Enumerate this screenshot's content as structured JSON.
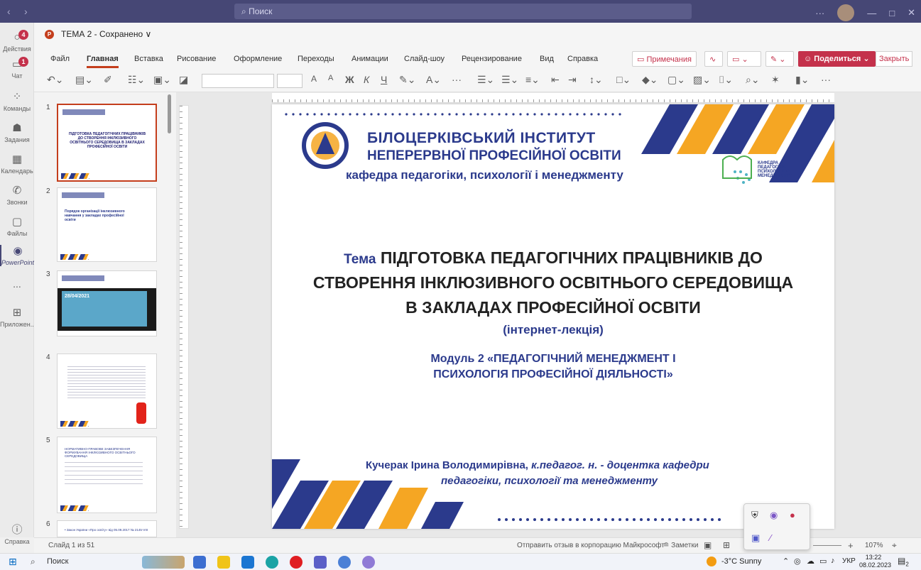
{
  "titlebar": {
    "search_placeholder": "Поиск"
  },
  "rail": [
    {
      "label": "Действия",
      "icon": "bell-icon",
      "badge": "4"
    },
    {
      "label": "Чат",
      "icon": "chat-icon",
      "badge": "1"
    },
    {
      "label": "Команды",
      "icon": "teams-icon"
    },
    {
      "label": "Задания",
      "icon": "assignments-icon"
    },
    {
      "label": "Календарь",
      "icon": "calendar-icon"
    },
    {
      "label": "Звонки",
      "icon": "phone-icon"
    },
    {
      "label": "Файлы",
      "icon": "files-icon"
    },
    {
      "label": "PowerPoint",
      "icon": "powerpoint-icon"
    },
    {
      "label": "...",
      "icon": "more-icon"
    },
    {
      "label": "Приложен...",
      "icon": "apps-icon"
    },
    {
      "label": "Справка",
      "icon": "help-icon"
    }
  ],
  "document": {
    "logo": "P",
    "title": "ТЕМА 2 - Сохранено ∨"
  },
  "menu": [
    "Файл",
    "Главная",
    "Вставка",
    "Рисование",
    "Оформление",
    "Переходы",
    "Анимации",
    "Слайд-шоу",
    "Рецензирование",
    "Вид",
    "Справка"
  ],
  "header_buttons": {
    "comments": "Примечания",
    "share": "Поделиться",
    "close": "Закрыть"
  },
  "ribbon": {
    "font_size_a": "A",
    "font_size_b": "A",
    "bold": "Ж",
    "italic": "К",
    "underline": "Ч",
    "more": "···"
  },
  "thumbnails": [
    {
      "num": "1",
      "title": "ПІДГОТОВКА ПЕДАГОГІЧНИХ ПРАЦІВНИКІВ ДО СТВОРЕННЯ ІНКЛЮЗИВНОГО ОСВІТНЬОГО СЕРЕДОВИЩА В ЗАКЛАДАХ ПРОФЕСІЙНОЇ ОСВІТИ"
    },
    {
      "num": "2",
      "title": "Порядок організації інклюзивного навчання у закладах професійної освіти"
    },
    {
      "num": "3",
      "title": "28/04/2021"
    },
    {
      "num": "4",
      "title": ""
    },
    {
      "num": "5",
      "title": "НОРМАТИВНО-ПРАВОВЕ ЗАБЕЗПЕЧЕННЯ ФОРМУВАННЯ ІНКЛЮЗИВНОГО ОСВІТНЬОГО СЕРЕДОВИЩА"
    },
    {
      "num": "6",
      "title": "• Закон України «Про освіту» від 05.09.2017 № 2145-VIII"
    }
  ],
  "slide": {
    "institute_line1": "БІЛОЦЕРКІВСЬКИЙ ІНСТИТУТ",
    "institute_line2": "НЕПЕРЕРВНОЇ ПРОФЕСІЙНОЇ ОСВІТИ",
    "department": "кафедра педагогіки, психології і менеджменту",
    "dept_logo_text": "КАФЕДРА ПЕДАГОГІКИ, ПСИХОЛОГІЇ ТА МЕНЕДЖМЕНТУ",
    "topic_prefix": "Тема",
    "topic_line1": "ПІДГОТОВКА ПЕДАГОГІЧНИХ ПРАЦІВНИКІВ ДО",
    "topic_line2": "СТВОРЕННЯ ІНКЛЮЗИВНОГО ОСВІТНЬОГО СЕРЕДОВИЩА",
    "topic_line3": "В ЗАКЛАДАХ ПРОФЕСІЙНОЇ ОСВІТИ",
    "subtitle": "(інтернет-лекція)",
    "module_line1": "Модуль 2 «ПЕДАГОГІЧНИЙ МЕНЕДЖМЕНТ І",
    "module_line2": "ПСИХОЛОГІЯ ПРОФЕСІЙНОЇ ДІЯЛЬНОСТІ»",
    "author_name": "Кучерак Ірина Володимирівна,",
    "author_role1": "к.педагог. н. - доцентка кафедри",
    "author_role2": "педагогіки, психології та менеджменту"
  },
  "statusbar": {
    "slide_count": "Слайд 1 из 51",
    "feedback": "Отправить отзыв в корпорацию Майкрософт",
    "notes": "≘ Заметки",
    "zoom": "107%"
  },
  "taskbar": {
    "search": "Поиск",
    "weather": "-3°C Sunny",
    "lang": "УКР",
    "time": "13:22",
    "date": "08.02.2023",
    "notif": "2"
  },
  "colors": {
    "teams": "#464775",
    "accent": "#c43e1c",
    "slide_blue": "#2b3a8c",
    "slide_orange": "#f5a623",
    "share": "#c4314b"
  }
}
